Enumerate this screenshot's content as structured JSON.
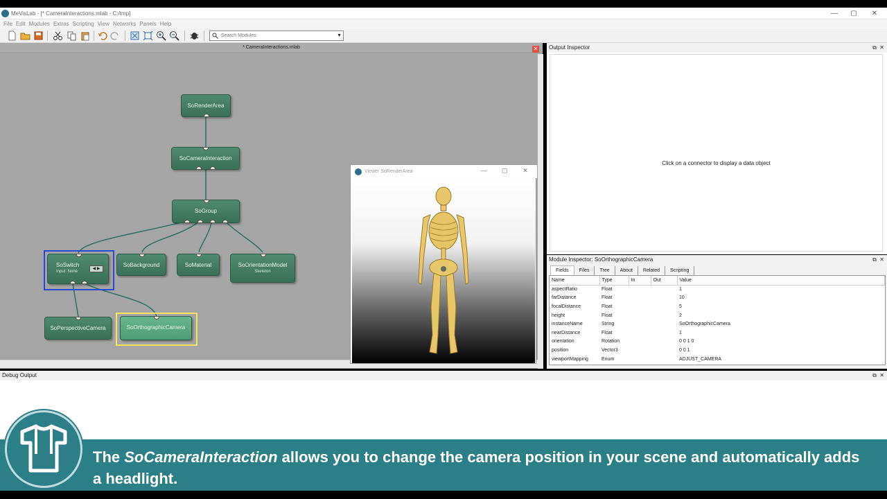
{
  "window": {
    "title": "MeVisLab - [* CameraInteractions.mlab - C:/tmp]",
    "controls": [
      "—",
      "▢",
      "✕"
    ]
  },
  "menubar": [
    "File",
    "Edit",
    "Modules",
    "Extras",
    "Scripting",
    "View",
    "Networks",
    "Panels",
    "Help"
  ],
  "toolbar": {
    "search_placeholder": "Search Modules"
  },
  "network": {
    "tab_title": "* CameraInteractions.mlab",
    "modules": {
      "render_area": "SoRenderArea",
      "camera_interaction": "SoCameraInteraction",
      "group": "SoGroup",
      "switch": "SoSwitch",
      "switch_sub": "Input: None",
      "background": "SoBackground",
      "material": "SoMaterial",
      "orientation_model": "SoOrientationModel",
      "orientation_sub": "Skeleton",
      "perspective_camera": "SoPerspectiveCamera",
      "orthographic_camera": "SoOrthographicCamera"
    }
  },
  "viewer": {
    "title": "Viewer SoRenderArea"
  },
  "output_inspector": {
    "title": "Output Inspector",
    "message": "Click on a connector to display a data object"
  },
  "module_inspector": {
    "title": "Module Inspector: SoOrthographicCamera",
    "tabs": [
      "Fields",
      "Files",
      "Tree",
      "About",
      "Related",
      "Scripting"
    ],
    "columns": [
      "Name",
      "Type",
      "In",
      "Out",
      "Value"
    ],
    "rows": [
      {
        "name": "aspectRatio",
        "type": "Float",
        "value": "1"
      },
      {
        "name": "farDistance",
        "type": "Float",
        "value": "10"
      },
      {
        "name": "focalDistance",
        "type": "Float",
        "value": "5"
      },
      {
        "name": "height",
        "type": "Float",
        "value": "2"
      },
      {
        "name": "instanceName",
        "type": "String",
        "value": "SoOrthographicCamera"
      },
      {
        "name": "nearDistance",
        "type": "Float",
        "value": "1"
      },
      {
        "name": "orientation",
        "type": "Rotation",
        "value": "0 0 1 0"
      },
      {
        "name": "position",
        "type": "Vector3",
        "value": "0 0 1"
      },
      {
        "name": "viewportMapping",
        "type": "Enum",
        "value": "ADJUST_CAMERA"
      }
    ]
  },
  "debug": {
    "title": "Debug Output"
  },
  "caption": {
    "prefix": "The ",
    "emphasis": "SoCameraInteraction",
    "suffix": " allows you to change the camera position in your scene and automatically adds a headlight."
  }
}
